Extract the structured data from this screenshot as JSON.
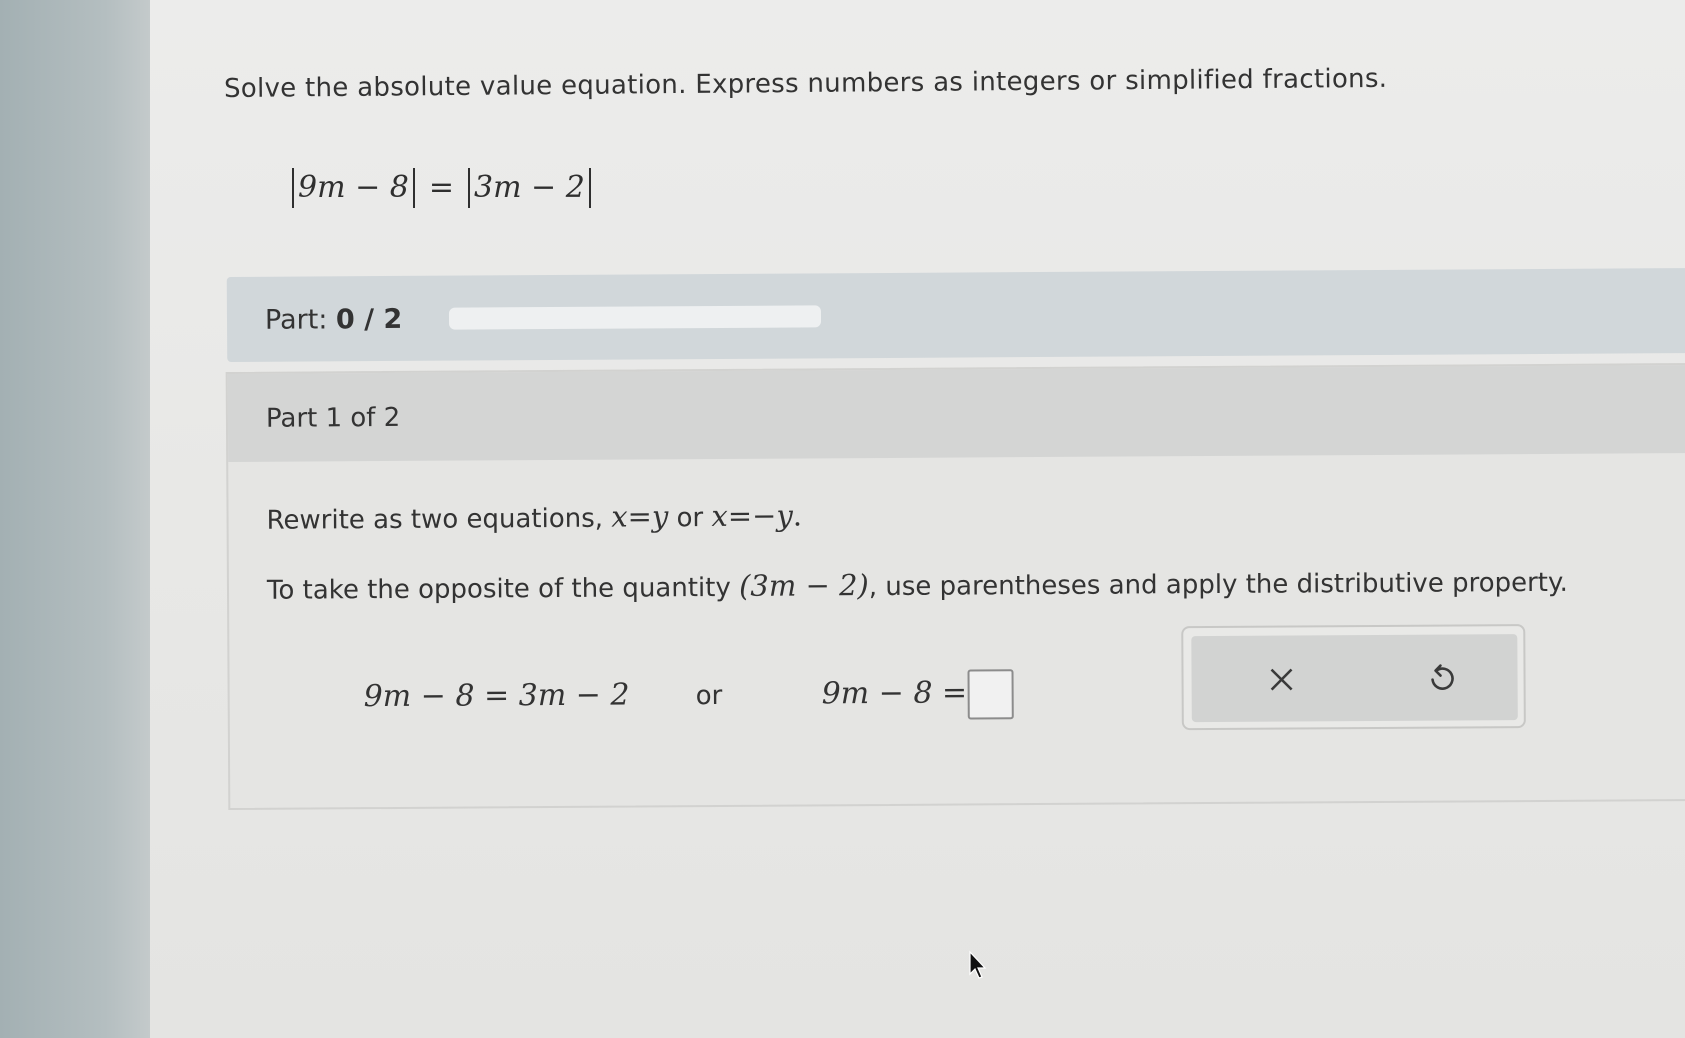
{
  "question": {
    "instruction": "Solve the absolute value equation. Express numbers as integers or simplified fractions.",
    "equation": {
      "left": "9m − 8",
      "eq": "=",
      "right": "3m − 2"
    }
  },
  "progress": {
    "label": "Part:",
    "value": "0 / 2",
    "fraction": 0
  },
  "part": {
    "header": "Part 1 of 2",
    "instruction1_prefix": "Rewrite as two equations,",
    "instruction1_eq1": "x=y",
    "instruction1_or": "or",
    "instruction1_eq2": "x=−y",
    "instruction1_end": ".",
    "instruction2_prefix": "To take the opposite of the quantity",
    "instruction2_math": "(3m − 2)",
    "instruction2_suffix": ", use parentheses and apply the distributive property.",
    "eq_first": "9m − 8 = 3m − 2",
    "or_word": "or",
    "eq_second_left": "9m − 8 =",
    "answer_value": ""
  },
  "tools": {
    "clear_icon": "close-x-icon",
    "undo_icon": "undo-icon"
  },
  "colors": {
    "progress_bar": "#d1d7da",
    "panel_header": "#d4d5d4",
    "tool_box": "#d2d3d2"
  }
}
